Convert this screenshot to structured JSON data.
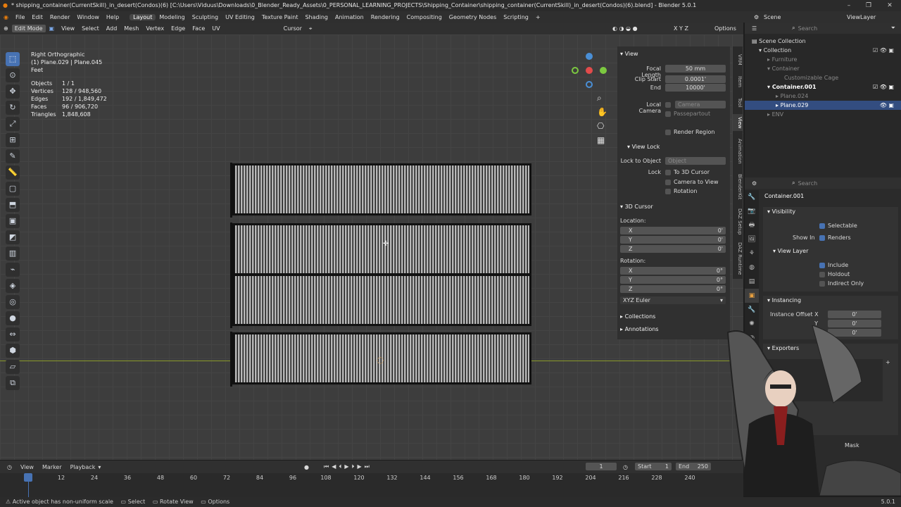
{
  "title_bar": {
    "text": "* shipping_container(CurrentSkill)_in_desert(Condos)(6) [C:\\Users\\Viduus\\Downloads\\0_Blender_Ready_Assets\\0_PERSONAL_LEARNING_PROJECTS\\Shipping_Container\\shipping_container(CurrentSkill)_in_desert(Condos)(6).blend] - Blender 5.0.1",
    "min": "–",
    "max": "❐",
    "close": "✕"
  },
  "menu": {
    "file": "File",
    "edit": "Edit",
    "render": "Render",
    "window": "Window",
    "help": "Help"
  },
  "workspaces": [
    "Layout",
    "Modeling",
    "Sculpting",
    "UV Editing",
    "Texture Paint",
    "Shading",
    "Animation",
    "Rendering",
    "Compositing",
    "Geometry Nodes",
    "Scripting"
  ],
  "top_right": {
    "scene": "Scene",
    "view_layer": "ViewLayer"
  },
  "viewport_header": {
    "mode": "Edit Mode",
    "view": "View",
    "select": "Select",
    "add": "Add",
    "mesh": "Mesh",
    "vertex": "Vertex",
    "edge": "Edge",
    "face": "Face",
    "uv": "UV",
    "pivot": "Cursor",
    "options": "Options",
    "axes": "X Y Z"
  },
  "overlay": {
    "view_name": "Right Orthographic",
    "object_name": "(1) Plane.029 | Plane.045",
    "units": "Feet",
    "stats": [
      {
        "k": "Objects",
        "v": "1 / 1"
      },
      {
        "k": "Vertices",
        "v": "128 / 948,560"
      },
      {
        "k": "Edges",
        "v": "192 / 1,849,472"
      },
      {
        "k": "Faces",
        "v": "96 / 906,720"
      },
      {
        "k": "Triangles",
        "v": "1,848,608"
      }
    ]
  },
  "npanel": {
    "view_title": "View",
    "focal_length_label": "Focal Length",
    "focal_length": "50 mm",
    "clip_start_label": "Clip Start",
    "clip_start": "0.0001'",
    "end_label": "End",
    "end": "10000'",
    "local_camera_label": "Local Camera",
    "camera": "Camera",
    "passepartout": "Passepartout",
    "render_region": "Render Region",
    "view_lock_title": "View Lock",
    "lock_to_object_label": "Lock to Object",
    "object_placeholder": "Object",
    "lock_label": "Lock",
    "to_3d_cursor": "To 3D Cursor",
    "camera_to_view": "Camera to View",
    "rotation_lock": "Rotation",
    "cursor_title": "3D Cursor",
    "location_label": "Location:",
    "rotation_label": "Rotation:",
    "x": "X",
    "y": "Y",
    "z": "Z",
    "zero": "0'",
    "zero_deg": "0°",
    "euler": "XYZ Euler",
    "collections": "Collections",
    "annotations": "Annotations"
  },
  "side_tabs": [
    "VRM",
    "Item",
    "Tool",
    "View",
    "Animation",
    "BlenderKit",
    "DAZ Setup",
    "DAZ Runtime"
  ],
  "outliner": {
    "search_placeholder": "Search",
    "rows": [
      {
        "label": "Scene Collection",
        "indent": 0
      },
      {
        "label": "Collection",
        "indent": 1
      },
      {
        "label": "Furniture",
        "indent": 2
      },
      {
        "label": "Container",
        "indent": 2
      },
      {
        "label": "Customizable Cage",
        "indent": 3
      },
      {
        "label": "Container.001",
        "indent": 2
      },
      {
        "label": "Plane.024",
        "indent": 3
      },
      {
        "label": "Plane.029",
        "indent": 3
      },
      {
        "label": "ENV",
        "indent": 2
      }
    ]
  },
  "properties": {
    "search_placeholder": "Search",
    "object": "Container.001",
    "visibility": "Visibility",
    "selectable": "Selectable",
    "show_in": "Show In",
    "renders": "Renders",
    "view_layer": "View Layer",
    "include": "Include",
    "holdout": "Holdout",
    "indirect_only": "Indirect Only",
    "instancing": "Instancing",
    "instance_offset_x": "Instance Offset X",
    "y": "Y",
    "offset_value": "0'",
    "exporters": "Exporters",
    "mask": "Mask"
  },
  "timeline": {
    "view": "View",
    "marker": "Marker",
    "playback": "Playback",
    "current_frame": "1",
    "start_label": "Start",
    "start": "1",
    "end_label": "End",
    "end": "250",
    "frames": [
      "1",
      "12",
      "24",
      "36",
      "48",
      "60",
      "72",
      "84",
      "96",
      "108",
      "120",
      "132",
      "144",
      "156",
      "168",
      "180",
      "192",
      "204",
      "216",
      "228",
      "240"
    ]
  },
  "status": {
    "message": "Active object has non-uniform scale",
    "select": "Select",
    "rotate_view": "Rotate View",
    "options": "Options",
    "version": "5.0.1"
  }
}
